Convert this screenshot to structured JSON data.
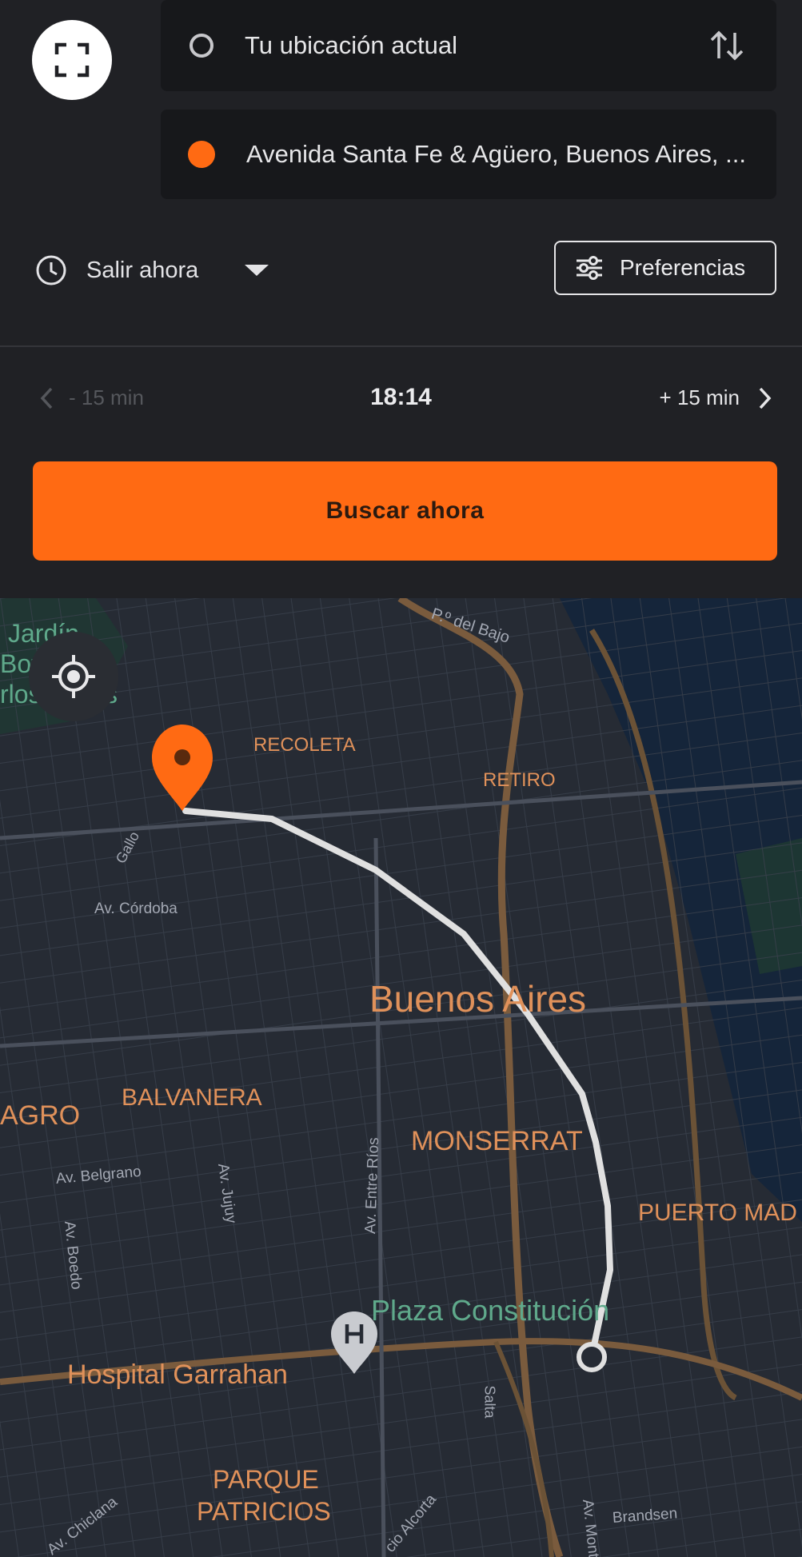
{
  "search": {
    "origin": "Tu ubicación actual",
    "destination": "Avenida Santa Fe & Agüero, Buenos Aires, ...",
    "depart_label": "Salir ahora",
    "preferences_label": "Preferencias",
    "time_prev": "- 15 min",
    "time_current": "18:14",
    "time_next": "+ 15 min",
    "search_button": "Buscar ahora"
  },
  "colors": {
    "accent": "#ff6a13",
    "panel": "#202125",
    "map_background": "#262b34",
    "route": "#e0e0e0"
  },
  "map": {
    "labels": {
      "jardin": "Jardín",
      "botanico": "Bot",
      "carlos_thays": "rlos Thays",
      "paseo_bajo": "P.º del Bajo",
      "recoleta": "RECOLETA",
      "retiro": "RETIRO",
      "gallo": "Gallo",
      "av_cordoba": "Av. Córdoba",
      "city": "Buenos Aires",
      "almagro": "AGRO",
      "balvanera": "BALVANERA",
      "monserrat": "MONSERRAT",
      "av_belgrano": "Av. Belgrano",
      "av_jujuy": "Av. Jujuy",
      "av_entre_rios": "Av. Entre Ríos",
      "av_boedo": "Av. Boedo",
      "puerto_madero": "PUERTO MAD",
      "plaza_constitucion": "Plaza Constitución",
      "hospital": "Hospital Garrahan",
      "salta": "Salta",
      "parque": "PARQUE",
      "patricios": "PATRICIOS",
      "av_chiclana": "Av. Chiclana",
      "alcorta": "cio Alcorta",
      "av_montes": "Av. Montes",
      "brandsen": "Brandsen"
    }
  }
}
